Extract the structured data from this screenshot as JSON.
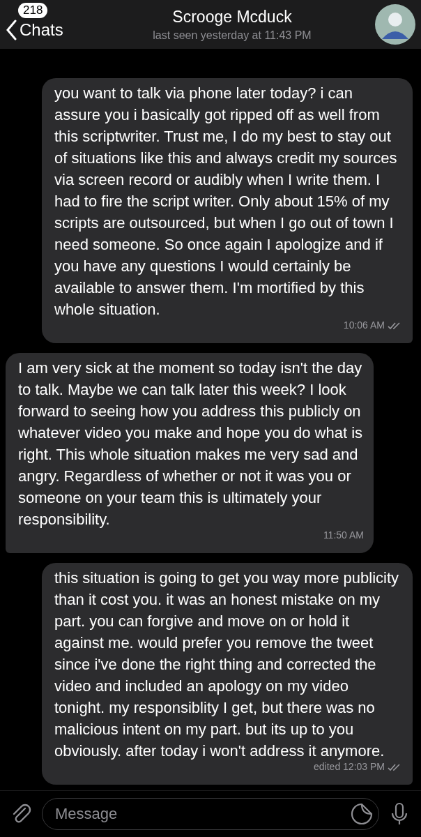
{
  "header": {
    "back_label": "Chats",
    "unread_badge": "218",
    "title": "Scrooge Mcduck",
    "status": "last seen yesterday at 11:43 PM"
  },
  "messages": [
    {
      "kind": "outgoing",
      "text": "you want to talk via phone later today? i can assure you i basically got ripped off as well from this scriptwriter. Trust me, I do my best to stay out of situations like this and always credit my sources via screen record or audibly when I write them. I had to fire the script writer. Only about 15% of my scripts are outsourced, but when I go out of town I need someone. So once again I apologize and if you have any questions I would certainly be available to answer them. I'm mortified by this whole situation.",
      "time": "10:06 AM",
      "read": true
    },
    {
      "kind": "incoming",
      "text": "I am very sick at the moment so today isn't the day to talk. Maybe we can talk later this week? I look forward to seeing how you address this publicly on whatever video you make and hope you do what is right. This whole situation makes me very sad and angry. Regardless of whether or not it was you or someone on your team this is ultimately your responsibility.",
      "time": "11:50 AM",
      "read": false
    },
    {
      "kind": "outgoing",
      "text": "this situation is going to get you way more publicity than it cost you. it was an honest mistake on my part. you can forgive and move on or hold it against me. would prefer you remove the tweet since i've done the right thing and corrected the video and included an apology on my video tonight. my responsiblity I get, but there was no malicious intent on my part. but its up to you obviously. after today i won't address it anymore.",
      "time": "edited 12:03 PM",
      "read": true
    }
  ],
  "composer": {
    "placeholder": "Message"
  }
}
